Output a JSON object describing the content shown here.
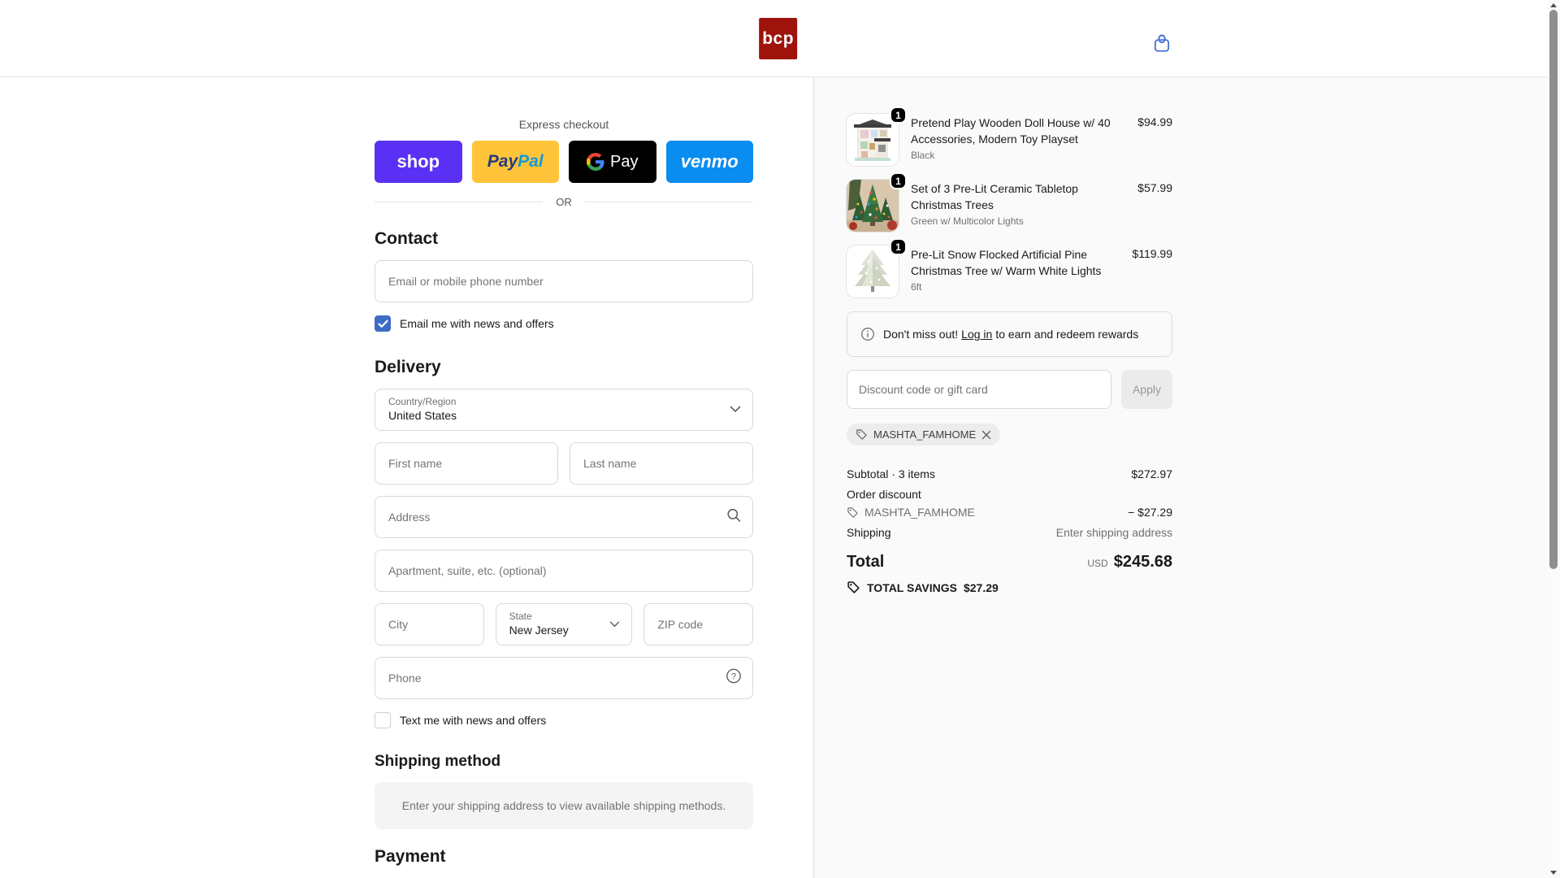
{
  "header": {
    "logo": "bcp",
    "brand_red": "#9e130c",
    "cart_icon_color": "#4a72d8"
  },
  "express": {
    "label": "Express checkout",
    "divider": "OR",
    "shop_label": "shop",
    "paypal_pay": "Pay",
    "paypal_pal": "Pal",
    "gpay_label": "Pay",
    "venmo_label": "venmo",
    "colors": {
      "shop": "#5a31f4",
      "paypal": "#ffc439",
      "gpay": "#000000",
      "venmo": "#0a8cf0"
    }
  },
  "contact": {
    "heading": "Contact",
    "email_placeholder": "Email or mobile phone number",
    "news_checkbox_label": "Email me with news and offers",
    "news_checked": true
  },
  "delivery": {
    "heading": "Delivery",
    "country_label": "Country/Region",
    "country_value": "United States",
    "first_name_placeholder": "First name",
    "last_name_placeholder": "Last name",
    "address_placeholder": "Address",
    "apartment_placeholder": "Apartment, suite, etc. (optional)",
    "city_placeholder": "City",
    "state_label": "State",
    "state_value": "New Jersey",
    "zip_placeholder": "ZIP code",
    "phone_placeholder": "Phone",
    "sms_checkbox_label": "Text me with news and offers",
    "sms_checked": false
  },
  "shipping_method": {
    "heading": "Shipping method",
    "notice": "Enter your shipping address to view available shipping methods."
  },
  "payment": {
    "heading": "Payment"
  },
  "order_summary": {
    "items": [
      {
        "qty": "1",
        "title": "Pretend Play Wooden Doll House w/ 40 Accessories, Modern Toy Playset",
        "variant": "Black",
        "price": "$94.99"
      },
      {
        "qty": "1",
        "title": "Set of 3 Pre-Lit Ceramic Tabletop Christmas Trees",
        "variant": "Green w/ Multicolor Lights",
        "price": "$57.99"
      },
      {
        "qty": "1",
        "title": "Pre-Lit Snow Flocked Artificial Pine Christmas Tree w/ Warm White Lights",
        "variant": "6ft",
        "price": "$119.99"
      }
    ],
    "rewards": {
      "prefix": "Don't miss out!",
      "link": "Log in",
      "suffix": "to earn and redeem rewards"
    },
    "discount": {
      "placeholder": "Discount code or gift card",
      "apply_label": "Apply",
      "applied_code": "MASHTA_FAMHOME"
    },
    "totals": {
      "subtotal_label": "Subtotal · 3 items",
      "subtotal": "$272.97",
      "discount_label": "Order discount",
      "discount_code": "MASHTA_FAMHOME",
      "discount_amount": "− $27.29",
      "shipping_label": "Shipping",
      "shipping_value": "Enter shipping address",
      "total_label": "Total",
      "currency": "USD",
      "total": "$245.68",
      "savings_label": "TOTAL SAVINGS",
      "savings_amount": "$27.29"
    }
  },
  "accent": {
    "checkbox_blue": "#3e6bc5"
  }
}
